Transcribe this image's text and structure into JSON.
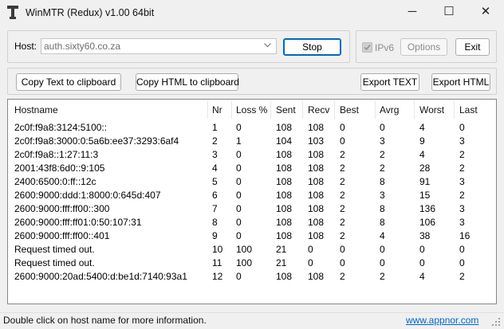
{
  "window": {
    "title": "WinMTR (Redux) v1.00 64bit",
    "controls": {
      "minimize": "─",
      "maximize": "☐",
      "close": "✕"
    }
  },
  "host_group": {
    "host_label": "Host:",
    "host_value": "auth.sixty60.co.za",
    "stop_label": "Stop"
  },
  "options_group": {
    "ipv6_label": "IPv6",
    "ipv6_checked": true,
    "options_label": "Options",
    "exit_label": "Exit"
  },
  "export_bar": {
    "copy_text_label": "Copy Text to clipboard",
    "copy_html_label": "Copy HTML to clipboard",
    "export_text_label": "Export TEXT",
    "export_html_label": "Export HTML"
  },
  "table": {
    "columns": [
      "Hostname",
      "Nr",
      "Loss %",
      "Sent",
      "Recv",
      "Best",
      "Avrg",
      "Worst",
      "Last"
    ],
    "rows": [
      [
        "2c0f:f9a8:3124:5100::",
        "1",
        "0",
        "108",
        "108",
        "0",
        "0",
        "4",
        "0"
      ],
      [
        "2c0f:f9a8:3000:0:5a6b:ee37:3293:6af4",
        "2",
        "1",
        "104",
        "103",
        "0",
        "3",
        "9",
        "3"
      ],
      [
        "2c0f:f9a8::1:27:11:3",
        "3",
        "0",
        "108",
        "108",
        "2",
        "2",
        "4",
        "2"
      ],
      [
        "2001:43f8:6d0::9:105",
        "4",
        "0",
        "108",
        "108",
        "2",
        "2",
        "28",
        "2"
      ],
      [
        "2400:6500:0:ff::12c",
        "5",
        "0",
        "108",
        "108",
        "2",
        "8",
        "91",
        "3"
      ],
      [
        "2600:9000:ddd:1:8000:0:645d:407",
        "6",
        "0",
        "108",
        "108",
        "2",
        "3",
        "15",
        "2"
      ],
      [
        "2600:9000:fff:ff00::300",
        "7",
        "0",
        "108",
        "108",
        "2",
        "8",
        "136",
        "3"
      ],
      [
        "2600:9000:fff:ff01:0:50:107:31",
        "8",
        "0",
        "108",
        "108",
        "2",
        "8",
        "106",
        "3"
      ],
      [
        "2600:9000:fff:ff00::401",
        "9",
        "0",
        "108",
        "108",
        "2",
        "4",
        "38",
        "16"
      ],
      [
        "Request timed out.",
        "10",
        "100",
        "21",
        "0",
        "0",
        "0",
        "0",
        "0"
      ],
      [
        "Request timed out.",
        "11",
        "100",
        "21",
        "0",
        "0",
        "0",
        "0",
        "0"
      ],
      [
        "2600:9000:20ad:5400:d:be1d:7140:93a1",
        "12",
        "0",
        "108",
        "108",
        "2",
        "2",
        "4",
        "2"
      ]
    ]
  },
  "statusbar": {
    "text": "Double click on host name for more information.",
    "link": "www.appnor.com"
  },
  "colors": {
    "link": "#0066cc",
    "primary_border": "#0067c0",
    "background": "#f0f0f0"
  }
}
